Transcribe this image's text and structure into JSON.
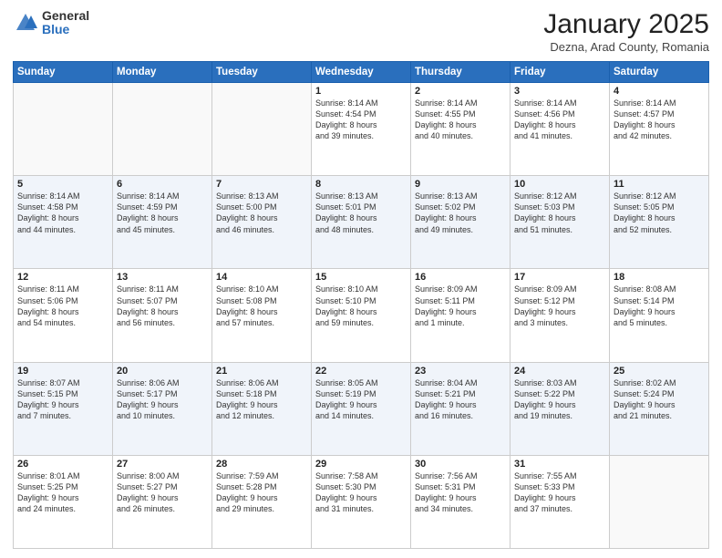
{
  "logo": {
    "general": "General",
    "blue": "Blue"
  },
  "title": "January 2025",
  "location": "Dezna, Arad County, Romania",
  "weekdays": [
    "Sunday",
    "Monday",
    "Tuesday",
    "Wednesday",
    "Thursday",
    "Friday",
    "Saturday"
  ],
  "weeks": [
    [
      {
        "day": "",
        "info": ""
      },
      {
        "day": "",
        "info": ""
      },
      {
        "day": "",
        "info": ""
      },
      {
        "day": "1",
        "info": "Sunrise: 8:14 AM\nSunset: 4:54 PM\nDaylight: 8 hours\nand 39 minutes."
      },
      {
        "day": "2",
        "info": "Sunrise: 8:14 AM\nSunset: 4:55 PM\nDaylight: 8 hours\nand 40 minutes."
      },
      {
        "day": "3",
        "info": "Sunrise: 8:14 AM\nSunset: 4:56 PM\nDaylight: 8 hours\nand 41 minutes."
      },
      {
        "day": "4",
        "info": "Sunrise: 8:14 AM\nSunset: 4:57 PM\nDaylight: 8 hours\nand 42 minutes."
      }
    ],
    [
      {
        "day": "5",
        "info": "Sunrise: 8:14 AM\nSunset: 4:58 PM\nDaylight: 8 hours\nand 44 minutes."
      },
      {
        "day": "6",
        "info": "Sunrise: 8:14 AM\nSunset: 4:59 PM\nDaylight: 8 hours\nand 45 minutes."
      },
      {
        "day": "7",
        "info": "Sunrise: 8:13 AM\nSunset: 5:00 PM\nDaylight: 8 hours\nand 46 minutes."
      },
      {
        "day": "8",
        "info": "Sunrise: 8:13 AM\nSunset: 5:01 PM\nDaylight: 8 hours\nand 48 minutes."
      },
      {
        "day": "9",
        "info": "Sunrise: 8:13 AM\nSunset: 5:02 PM\nDaylight: 8 hours\nand 49 minutes."
      },
      {
        "day": "10",
        "info": "Sunrise: 8:12 AM\nSunset: 5:03 PM\nDaylight: 8 hours\nand 51 minutes."
      },
      {
        "day": "11",
        "info": "Sunrise: 8:12 AM\nSunset: 5:05 PM\nDaylight: 8 hours\nand 52 minutes."
      }
    ],
    [
      {
        "day": "12",
        "info": "Sunrise: 8:11 AM\nSunset: 5:06 PM\nDaylight: 8 hours\nand 54 minutes."
      },
      {
        "day": "13",
        "info": "Sunrise: 8:11 AM\nSunset: 5:07 PM\nDaylight: 8 hours\nand 56 minutes."
      },
      {
        "day": "14",
        "info": "Sunrise: 8:10 AM\nSunset: 5:08 PM\nDaylight: 8 hours\nand 57 minutes."
      },
      {
        "day": "15",
        "info": "Sunrise: 8:10 AM\nSunset: 5:10 PM\nDaylight: 8 hours\nand 59 minutes."
      },
      {
        "day": "16",
        "info": "Sunrise: 8:09 AM\nSunset: 5:11 PM\nDaylight: 9 hours\nand 1 minute."
      },
      {
        "day": "17",
        "info": "Sunrise: 8:09 AM\nSunset: 5:12 PM\nDaylight: 9 hours\nand 3 minutes."
      },
      {
        "day": "18",
        "info": "Sunrise: 8:08 AM\nSunset: 5:14 PM\nDaylight: 9 hours\nand 5 minutes."
      }
    ],
    [
      {
        "day": "19",
        "info": "Sunrise: 8:07 AM\nSunset: 5:15 PM\nDaylight: 9 hours\nand 7 minutes."
      },
      {
        "day": "20",
        "info": "Sunrise: 8:06 AM\nSunset: 5:17 PM\nDaylight: 9 hours\nand 10 minutes."
      },
      {
        "day": "21",
        "info": "Sunrise: 8:06 AM\nSunset: 5:18 PM\nDaylight: 9 hours\nand 12 minutes."
      },
      {
        "day": "22",
        "info": "Sunrise: 8:05 AM\nSunset: 5:19 PM\nDaylight: 9 hours\nand 14 minutes."
      },
      {
        "day": "23",
        "info": "Sunrise: 8:04 AM\nSunset: 5:21 PM\nDaylight: 9 hours\nand 16 minutes."
      },
      {
        "day": "24",
        "info": "Sunrise: 8:03 AM\nSunset: 5:22 PM\nDaylight: 9 hours\nand 19 minutes."
      },
      {
        "day": "25",
        "info": "Sunrise: 8:02 AM\nSunset: 5:24 PM\nDaylight: 9 hours\nand 21 minutes."
      }
    ],
    [
      {
        "day": "26",
        "info": "Sunrise: 8:01 AM\nSunset: 5:25 PM\nDaylight: 9 hours\nand 24 minutes."
      },
      {
        "day": "27",
        "info": "Sunrise: 8:00 AM\nSunset: 5:27 PM\nDaylight: 9 hours\nand 26 minutes."
      },
      {
        "day": "28",
        "info": "Sunrise: 7:59 AM\nSunset: 5:28 PM\nDaylight: 9 hours\nand 29 minutes."
      },
      {
        "day": "29",
        "info": "Sunrise: 7:58 AM\nSunset: 5:30 PM\nDaylight: 9 hours\nand 31 minutes."
      },
      {
        "day": "30",
        "info": "Sunrise: 7:56 AM\nSunset: 5:31 PM\nDaylight: 9 hours\nand 34 minutes."
      },
      {
        "day": "31",
        "info": "Sunrise: 7:55 AM\nSunset: 5:33 PM\nDaylight: 9 hours\nand 37 minutes."
      },
      {
        "day": "",
        "info": ""
      }
    ]
  ]
}
